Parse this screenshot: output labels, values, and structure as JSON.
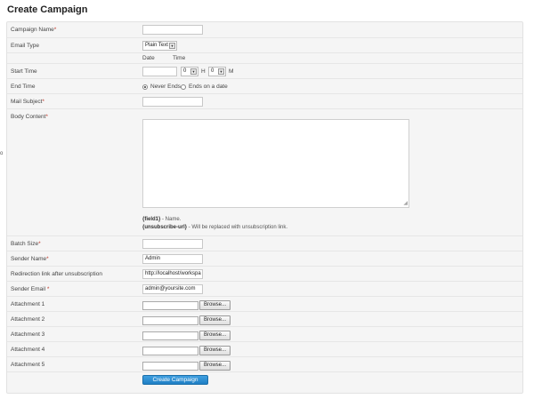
{
  "page": {
    "title": "Create Campaign",
    "edge_mark": "o"
  },
  "fields": {
    "campaign_name": {
      "label": "Campaign Name",
      "required": "*",
      "value": ""
    },
    "email_type": {
      "label": "Email Type",
      "value": "Plain Text"
    },
    "date_time_headers": {
      "date": "Date",
      "time": "Time"
    },
    "start_time": {
      "label": "Start Time",
      "date_value": "",
      "hour_value": "0",
      "hour_unit": "H",
      "minute_value": "0",
      "minute_unit": "M"
    },
    "end_time": {
      "label": "End Time",
      "option_never": "Never Ends",
      "option_date": "Ends on a date",
      "selected": "Never Ends"
    },
    "mail_subject": {
      "label": "Mail Subject",
      "required": "*",
      "value": ""
    },
    "body_content": {
      "label": "Body Content",
      "required": "*",
      "value": "",
      "hint1_token": "{field1}",
      "hint1_text": " - Name.",
      "hint2_token": "{unsubscribe-url}",
      "hint2_text": " - Will be replaced with unsubscription link."
    },
    "batch_size": {
      "label": "Batch Size",
      "required": "*",
      "value": ""
    },
    "sender_name": {
      "label": "Sender Name",
      "required": "*",
      "value": "Admin"
    },
    "redirection_link": {
      "label": "Redirection link after unsubscription",
      "value": "http://localhost/workspa"
    },
    "sender_email": {
      "label": "Sender Email ",
      "required": "*",
      "value": "admin@yoursite.com"
    },
    "attachments": [
      {
        "label": "Attachment 1",
        "button": "Browse..."
      },
      {
        "label": "Attachment 2",
        "button": "Browse..."
      },
      {
        "label": "Attachment 3",
        "button": "Browse..."
      },
      {
        "label": "Attachment 4",
        "button": "Browse..."
      },
      {
        "label": "Attachment 5",
        "button": "Browse..."
      }
    ]
  },
  "actions": {
    "submit_label": "Create Campaign"
  },
  "colors": {
    "accent": "#2a8dd4",
    "required": "#c0392b"
  }
}
